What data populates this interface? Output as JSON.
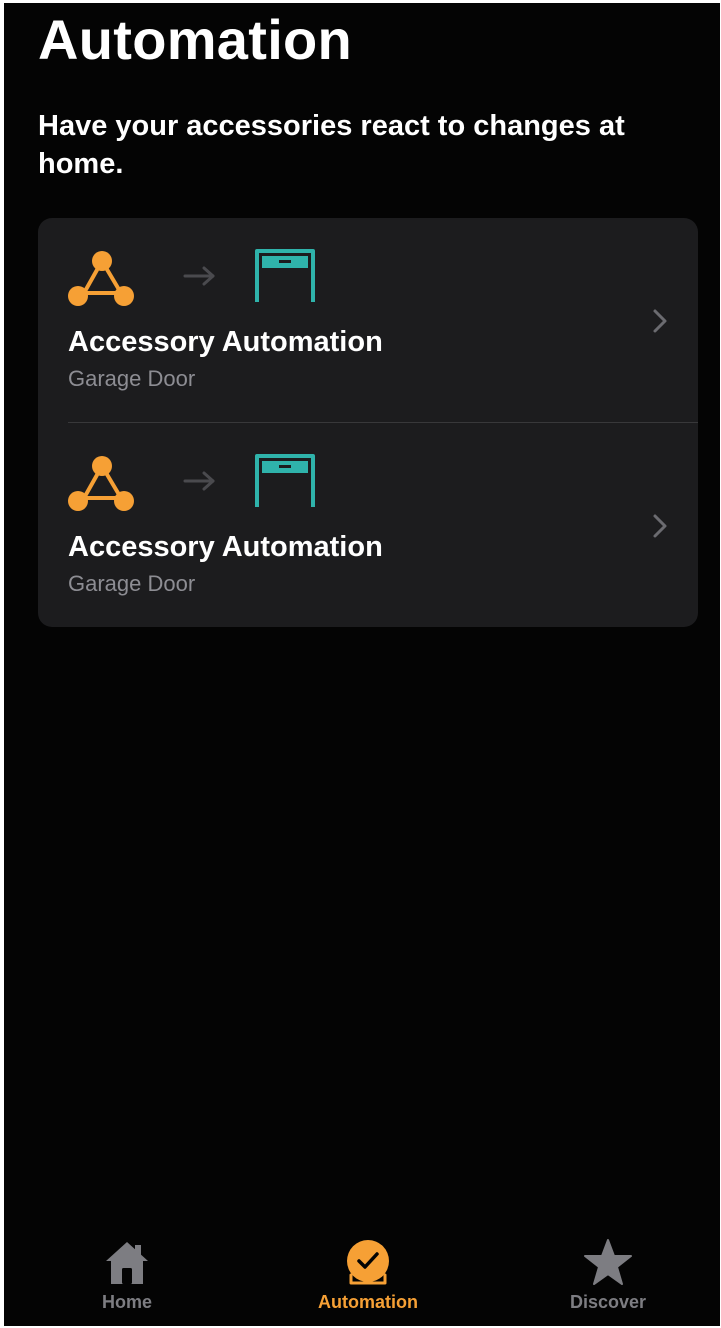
{
  "header": {
    "title": "Automation",
    "subtitle": "Have your accessories react to changes at home."
  },
  "automations": [
    {
      "title": "Accessory Automation",
      "subtitle": "Garage Door",
      "trigger_icon": "sensor-trigger-icon",
      "target_icon": "garage-door-icon"
    },
    {
      "title": "Accessory Automation",
      "subtitle": "Garage Door",
      "trigger_icon": "sensor-trigger-icon",
      "target_icon": "garage-door-icon"
    }
  ],
  "tabbar": {
    "tabs": [
      {
        "label": "Home",
        "icon": "home-icon",
        "selected": false
      },
      {
        "label": "Automation",
        "icon": "automation-icon",
        "selected": true
      },
      {
        "label": "Discover",
        "icon": "star-icon",
        "selected": false
      }
    ]
  },
  "colors": {
    "background": "#040404",
    "card": "#1c1c1e",
    "accent": "#f6a035",
    "garage": "#2fb3ab",
    "secondary_text": "#8d8d93",
    "inactive_tab": "#7d7d82"
  }
}
